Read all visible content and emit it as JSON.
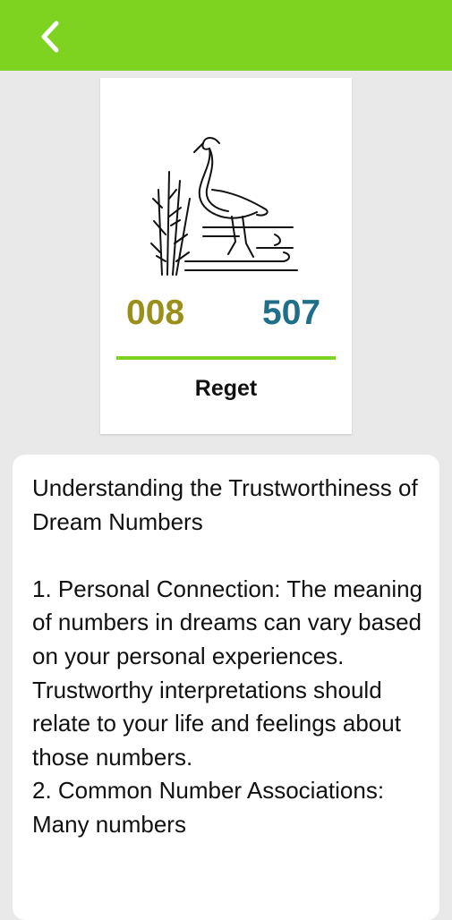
{
  "header": {
    "back_icon": "chevron-left-icon",
    "color": "#7ed321"
  },
  "card": {
    "image": "crane-illustration",
    "number_left": "008",
    "number_right": "507",
    "number_left_color": "#9a8f1b",
    "number_right_color": "#1f6f8b",
    "label": "Reget"
  },
  "article": {
    "text": "Understanding the Trustworthiness of Dream Numbers\n\n 1. Personal Connection: The meaning of numbers in dreams can vary based on your personal experiences. Trustworthy interpretations should relate to your life and feelings about those numbers.\n 2. Common Number Associations: Many numbers"
  }
}
